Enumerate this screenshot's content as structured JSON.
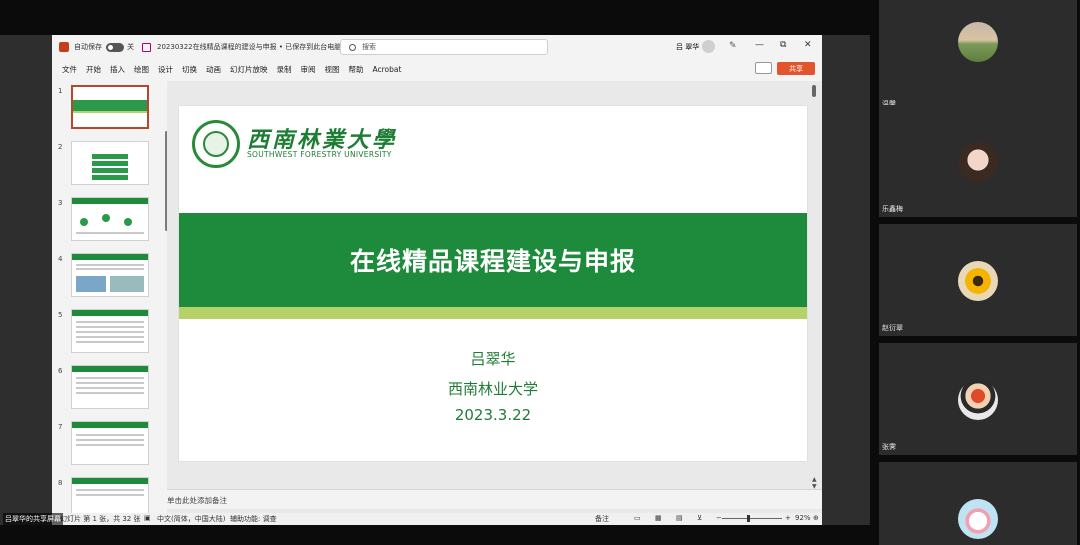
{
  "titlebar": {
    "autosave_label": "自动保存",
    "toggle_state": "关",
    "doc_title": "20230322在线精品课程的建设与申报 • 已保存到此台电脑",
    "search_placeholder": "搜索",
    "user_name": "吕 翠华",
    "minimize": "—",
    "restore": "⧉",
    "close": "✕"
  },
  "menu": [
    "文件",
    "开始",
    "插入",
    "绘图",
    "设计",
    "切换",
    "动画",
    "幻灯片放映",
    "录制",
    "审阅",
    "视图",
    "帮助",
    "Acrobat"
  ],
  "share_button": "共享",
  "thumbnails": [
    "1",
    "2",
    "3",
    "4",
    "5",
    "6",
    "7",
    "8"
  ],
  "slide": {
    "university_cn": "西南林業大學",
    "university_en": "SOUTHWEST FORESTRY UNIVERSITY",
    "title": "在线精品课程建设与申报",
    "author": "吕翠华",
    "affiliation": "西南林业大学",
    "date": "2023.3.22",
    "brand_green": "#1e8a3c",
    "accent_lime": "#b5d167"
  },
  "notes_placeholder": "单击此处添加备注",
  "statusbar": {
    "slide_info": "幻灯片 第 1 张，共 32 张",
    "language": "中文(简体，中国大陆)",
    "accessibility": "辅助功能: 调查",
    "notes_btn": "备注",
    "zoom": "92%"
  },
  "sharer_label": "吕翠华的共享屏幕",
  "participants": [
    {
      "name": "温馨",
      "avatar": "landscape-photo"
    },
    {
      "name": "乐鑫梅",
      "avatar": "girl-photo"
    },
    {
      "name": "赵衍翠",
      "avatar": "sunflower-photo"
    },
    {
      "name": "张霁",
      "avatar": "cartoon-avatar"
    },
    {
      "name": "",
      "avatar": "cartoon-animal"
    }
  ]
}
